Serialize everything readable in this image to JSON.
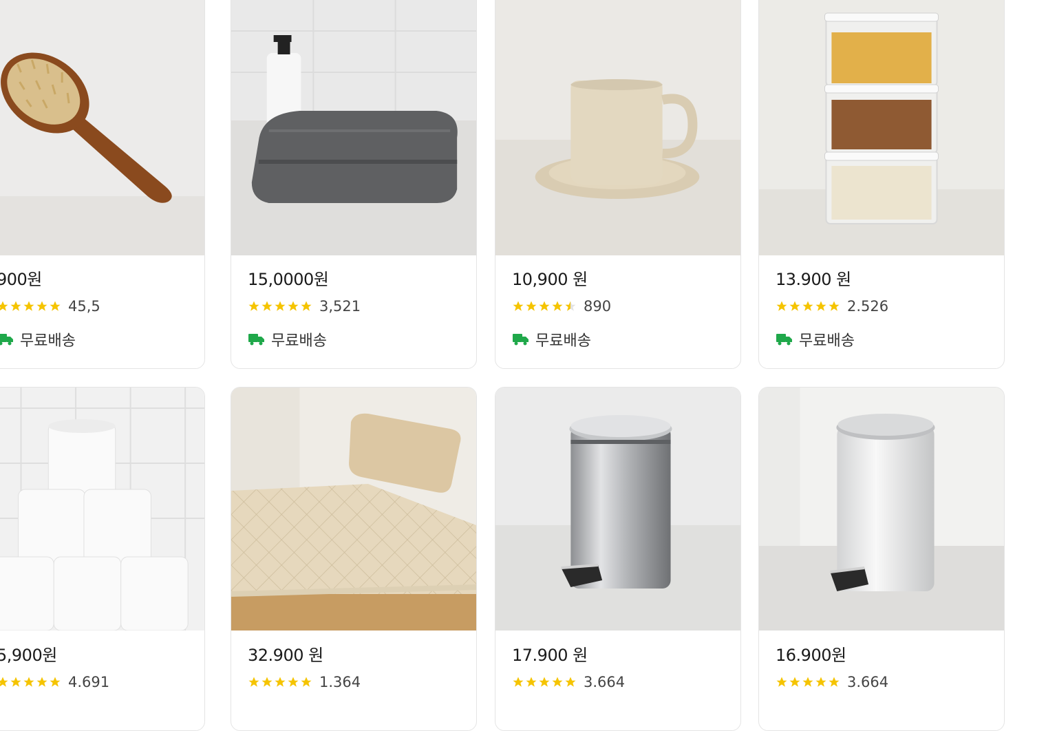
{
  "products": [
    {
      "price": "900원",
      "rating_count": "45,5",
      "shipping": "무료배송",
      "stars": 5,
      "image": "wooden-hairbrush"
    },
    {
      "price": "15,0000원",
      "rating_count": "3,521",
      "shipping": "무료배송",
      "stars": 5,
      "image": "gray-towel"
    },
    {
      "price": "10,900 원",
      "rating_count": "890",
      "shipping": "무료배송",
      "stars": 4.5,
      "image": "beige-mug"
    },
    {
      "price": "13.900 원",
      "rating_count": "2.526",
      "shipping": "무료배송",
      "stars": 5,
      "image": "food-containers"
    },
    {
      "price": "5,900원",
      "rating_count": "4.691",
      "stars": 5,
      "image": "toilet-paper"
    },
    {
      "price": "32.900 원",
      "rating_count": "1.364",
      "stars": 5,
      "image": "mattress-pad"
    },
    {
      "price": "17.900 원",
      "rating_count": "3.664",
      "stars": 5,
      "image": "steel-trash-can"
    },
    {
      "price": "16.900원",
      "rating_count": "3.664",
      "stars": 5,
      "image": "white-trash-can"
    }
  ],
  "colors": {
    "star": "#f5c400",
    "shipping_icon": "#1fa84a",
    "border": "#e4e4e4"
  }
}
